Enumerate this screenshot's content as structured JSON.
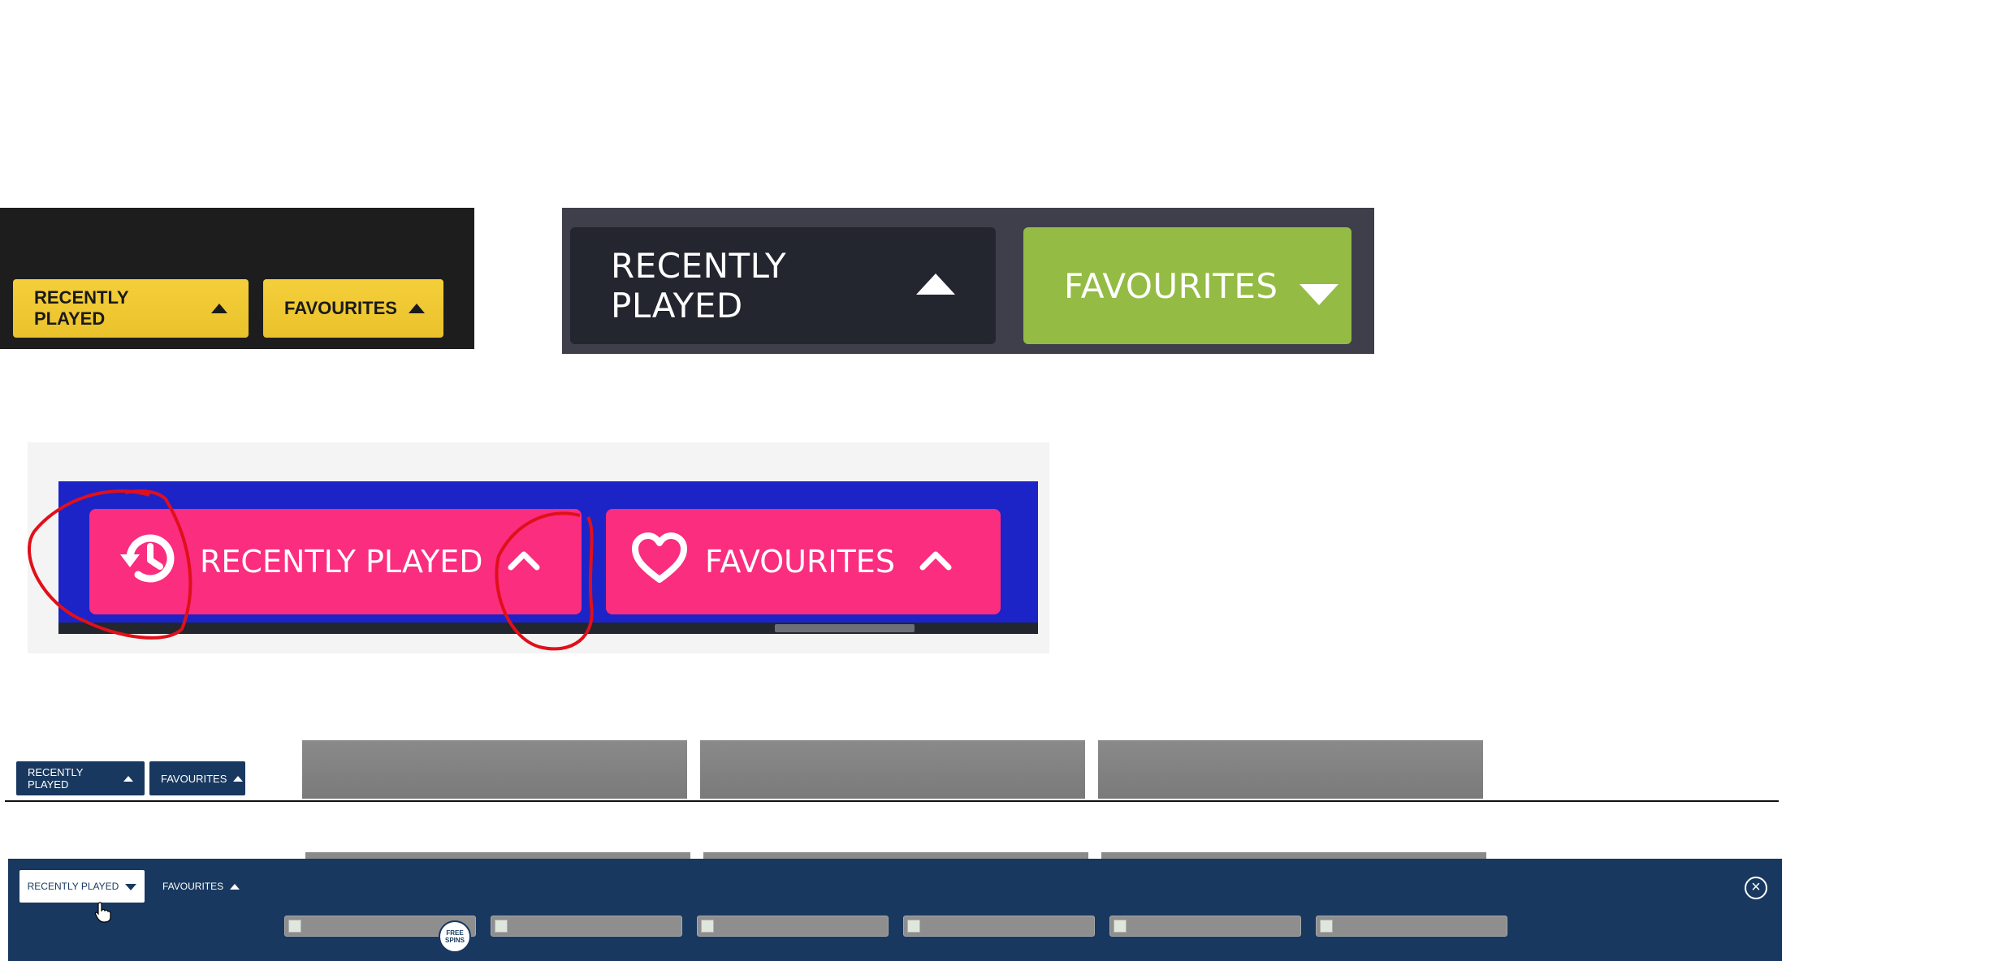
{
  "panel1": {
    "recently_played": "RECENTLY PLAYED",
    "favourites": "FAVOURITES",
    "colors": {
      "bg": "#1d1d1d",
      "button": "#f0c934"
    }
  },
  "panel2": {
    "recently_played": "RECENTLY PLAYED",
    "favourites": "FAVOURITES",
    "colors": {
      "frame": "#3e3f4a",
      "dark_button": "#23252f",
      "green_button": "#94bb44"
    }
  },
  "panel3": {
    "recently_played": "RECENTLY PLAYED",
    "favourites": "FAVOURITES",
    "icons": [
      "history-icon",
      "heart-icon",
      "chevron-up-icon"
    ],
    "colors": {
      "bar": "#1c24c8",
      "button": "#fa2d7f",
      "annotation": "#e0101a"
    }
  },
  "panel4": {
    "recently_played": "RECENTLY PLAYED",
    "favourites": "FAVOURITES",
    "colors": {
      "button": "#18385f"
    }
  },
  "panel5": {
    "recently_played": "RECENTLY PLAYED",
    "favourites": "FAVOURITES",
    "badge": "FREE SPINS",
    "close_icon": "close-circle-icon",
    "colors": {
      "drawer": "#18385f"
    }
  }
}
